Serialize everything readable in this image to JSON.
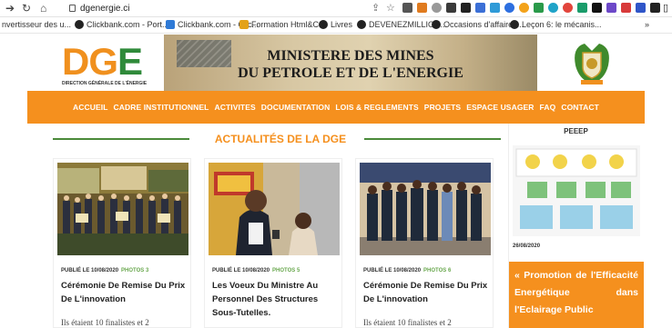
{
  "browser": {
    "url": "dgenergie.ci",
    "bookmarks": [
      "nvertisseur des u...",
      "Clickbank.com - Port...",
      "Clickbank.com - Clic...",
      "Formation Html&C...",
      "Livres",
      "DEVENEZMILLION...",
      "Occasions d'affaires...",
      "Leçon 6: le mécanis...",
      "»"
    ]
  },
  "header": {
    "logo_text": "DGE",
    "logo_subtitle": "DIRECTION GÉNÉRALE DE L'ÉNERGIE",
    "banner_line1": "MINISTERE DES MINES",
    "banner_line2": "DU PETROLE ET DE L'ENERGIE"
  },
  "menu": [
    "ACCUEIL",
    "CADRE INSTITUTIONNEL",
    "ACTIVITES",
    "DOCUMENTATION",
    "LOIS & REGLEMENTS",
    "PROJETS",
    "ESPACE USAGER",
    "FAQ",
    "CONTACT"
  ],
  "section_title": "ACTUALITÉS DE LA DGE",
  "cards": [
    {
      "meta": "PUBLIÉ LE 10/08/2020",
      "photos": "PHOTOS 3",
      "title": "Cérémonie De Remise Du Prix De L'innovation",
      "excerpt": "Ils étaient 10 finalistes et 2"
    },
    {
      "meta": "PUBLIÉ LE 10/08/2020",
      "photos": "PHOTOS 5",
      "title": "Les Voeux Du Ministre Au Personnel Des Structures Sous-Tutelles.",
      "excerpt": ""
    },
    {
      "meta": "PUBLIÉ LE 10/08/2020",
      "photos": "PHOTOS 6",
      "title": "Cérémonie De Remise Du Prix De L'innovation",
      "excerpt": "Ils étaient 10 finalistes et 2"
    }
  ],
  "sidebar": {
    "title": "PEEEP",
    "date": "26/08/2020",
    "promo": "« Promotion de l'Efficacité Energétique dans l'Eclairage Public"
  },
  "colors": {
    "accent": "#f5901e",
    "green": "#4a8a3a"
  }
}
